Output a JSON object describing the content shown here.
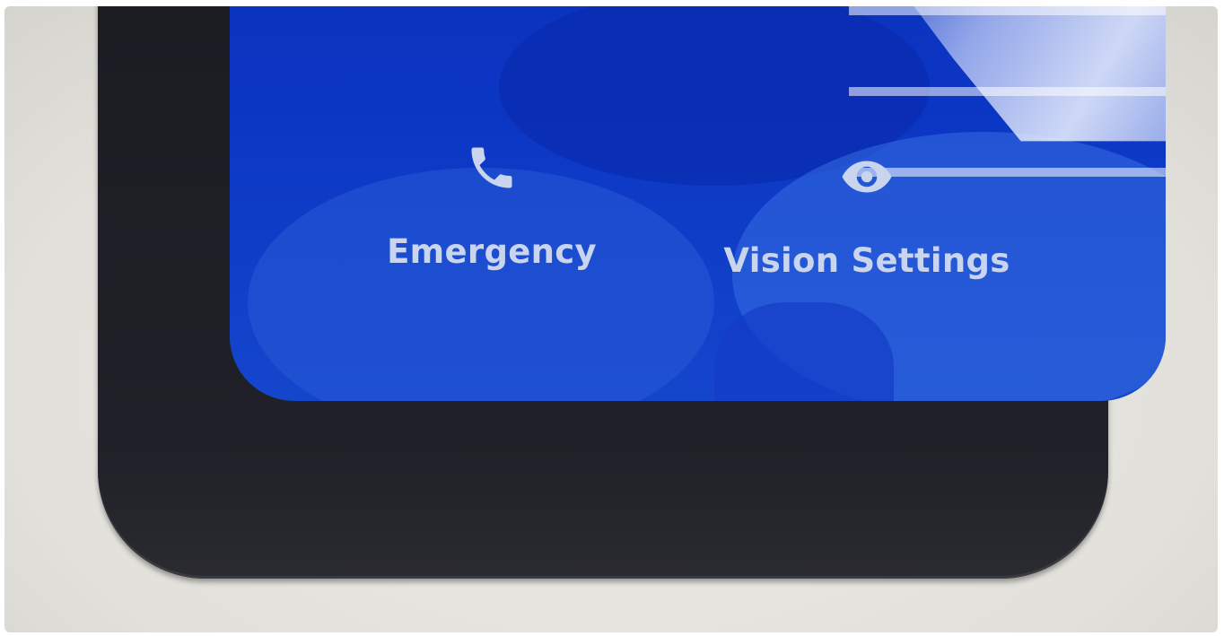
{
  "lock_screen": {
    "actions": [
      {
        "label": "Emergency",
        "icon": "phone-icon"
      },
      {
        "label": "Vision Settings",
        "icon": "eye-icon"
      }
    ]
  },
  "colors": {
    "screen_blue": "#0b36c4",
    "label_text": "#c9d4ee",
    "bezel": "#1b1c22",
    "background": "#e2e0da"
  }
}
